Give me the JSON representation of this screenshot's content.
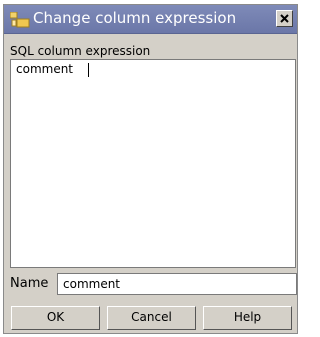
{
  "window": {
    "title": "Change column expression",
    "icon": "app-window-icon",
    "close_icon": "close-icon"
  },
  "expression": {
    "label": "SQL column expression",
    "value": "comment"
  },
  "name": {
    "label": "Name",
    "value": "comment"
  },
  "buttons": {
    "ok": "OK",
    "cancel": "Cancel",
    "help": "Help"
  }
}
